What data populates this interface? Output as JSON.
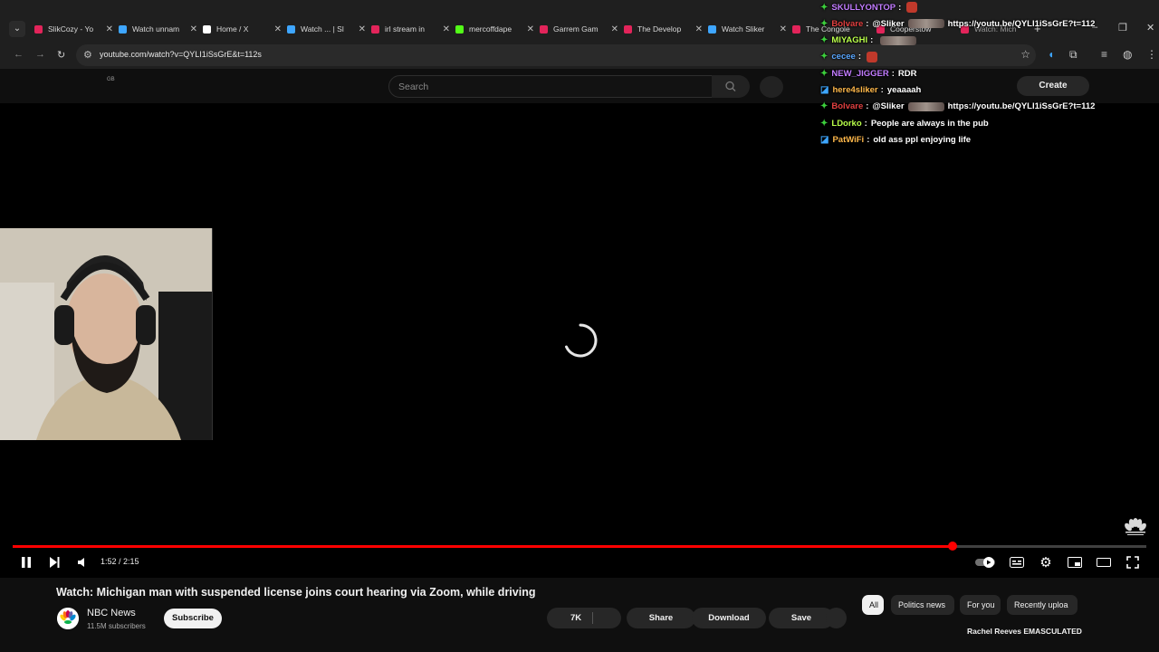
{
  "browser": {
    "tabs": [
      {
        "title": "SlikCozy - Yo",
        "fav": "#e2245a",
        "icon": "youtube-favicon-icon"
      },
      {
        "title": "Watch unnam",
        "fav": "#3ea6ff",
        "icon": "globe-favicon-icon"
      },
      {
        "title": "Home / X",
        "fav": "#ffffff",
        "icon": "x-favicon-icon"
      },
      {
        "title": "Watch ... | Sl",
        "fav": "#3ea6ff",
        "icon": "globe-favicon-icon"
      },
      {
        "title": "irl stream in",
        "fav": "#e2245a",
        "icon": "youtube-favicon-icon"
      },
      {
        "title": "mercoffdape",
        "fav": "#53fc18",
        "icon": "kick-favicon-icon"
      },
      {
        "title": "Garrem Gam",
        "fav": "#e2245a",
        "icon": "youtube-favicon-icon"
      },
      {
        "title": "The Develop",
        "fav": "#e2245a",
        "icon": "youtube-favicon-icon"
      },
      {
        "title": "Watch Sliker",
        "fav": "#3ea6ff",
        "icon": "globe-favicon-icon"
      },
      {
        "title": "The Congole",
        "fav": "#e2245a",
        "icon": "youtube-favicon-icon"
      },
      {
        "title": "Cooperstow",
        "fav": "#e2245a",
        "icon": "youtube-favicon-icon"
      },
      {
        "title": "Watch: Mich",
        "fav": "#e2245a",
        "icon": "youtube-favicon-icon"
      }
    ],
    "new_tab_glyph": "+",
    "url": "youtube.com/watch?v=QYLI1iSsGrE&t=112s"
  },
  "youtube": {
    "region": "GB",
    "search_placeholder": "Search",
    "create_label": "Create"
  },
  "player": {
    "timecode": "1:52 / 2:15",
    "progress_fraction": 0.829
  },
  "video": {
    "title": "Watch: Michigan man with suspended license joins court hearing via Zoom, while driving",
    "channel": "NBC News",
    "subscribers": "11.5M subscribers",
    "subscribe_label": "Subscribe",
    "likes": "7K",
    "share_label": "Share",
    "download_label": "Download",
    "save_label": "Save"
  },
  "chips": [
    "All",
    "Politics news",
    "For you",
    "Recently uploa"
  ],
  "recommendation": {
    "title": "Rachel Reeves EMASCULATED"
  },
  "chat": {
    "messages": [
      {
        "badge": "green",
        "user": "SKULLYONTOP",
        "color": "#c27cff",
        "text": "",
        "emote": true
      },
      {
        "badge": "green",
        "user": "Bolvare",
        "color": "#e24040",
        "text": "@Sliker",
        "link": "https://youtu.be/QYLI1iSsGrE?t=112",
        "blur": true
      },
      {
        "badge": "green",
        "user": "MIYAGHI",
        "color": "#b9ff4a",
        "text": "",
        "blur": true
      },
      {
        "badge": "green",
        "user": "cecee",
        "color": "#5aa7ff",
        "text": "",
        "emote": true
      },
      {
        "badge": "green",
        "user": "NEW_JIGGER",
        "color": "#c27cff",
        "text": "RDR"
      },
      {
        "badge": "blue",
        "user": "here4sliker",
        "color": "#ffb84a",
        "text": "yeaaaah"
      },
      {
        "badge": "green",
        "user": "Bolvare",
        "color": "#e24040",
        "text": "@Sliker",
        "link": "https://youtu.be/QYLI1iSsGrE?t=112",
        "blur": true
      },
      {
        "badge": "green",
        "user": "LDorko",
        "color": "#b9ff4a",
        "text": "People are always in the pub"
      },
      {
        "badge": "blue",
        "user": "PatWiFi",
        "color": "#ffb84a",
        "text": "old ass ppl enjoying life"
      }
    ]
  }
}
